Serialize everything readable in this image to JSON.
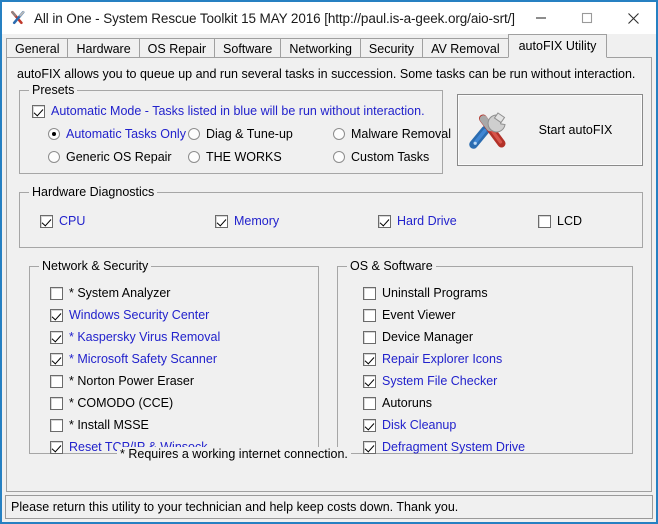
{
  "window": {
    "title": "All in One - System Rescue Toolkit 15 MAY 2016 [http://paul.is-a-geek.org/aio-srt/]",
    "app_icon": "crossed-tools-icon",
    "border_color": "#2680c2",
    "controls": {
      "minimize": "minimize-icon",
      "maximize": "maximize-icon",
      "close": "close-icon"
    }
  },
  "tabs": [
    {
      "label": "General",
      "active": false
    },
    {
      "label": "Hardware",
      "active": false
    },
    {
      "label": "OS Repair",
      "active": false
    },
    {
      "label": "Software",
      "active": false
    },
    {
      "label": "Networking",
      "active": false
    },
    {
      "label": "Security",
      "active": false
    },
    {
      "label": "AV Removal",
      "active": false
    },
    {
      "label": "autoFIX Utility",
      "active": true
    }
  ],
  "intro": "autoFIX allows you to queue up and run several tasks in succession.  Some tasks can be run without interaction.",
  "presets": {
    "title": "Presets",
    "automatic_mode": {
      "label": "Automatic Mode - Tasks listed in blue will be run without interaction.",
      "checked": true,
      "blue": true
    },
    "options": [
      {
        "label": "Automatic Tasks Only",
        "selected": true,
        "blue": true
      },
      {
        "label": "Diag & Tune-up",
        "selected": false,
        "blue": false
      },
      {
        "label": "Malware Removal",
        "selected": false,
        "blue": false
      },
      {
        "label": "Generic OS Repair",
        "selected": false,
        "blue": false
      },
      {
        "label": "THE WORKS",
        "selected": false,
        "blue": false
      },
      {
        "label": "Custom Tasks",
        "selected": false,
        "blue": false
      }
    ]
  },
  "start_button": {
    "label": "Start autoFIX",
    "icon": "screwdriver-wrench-icon"
  },
  "hardware_diagnostics": {
    "title": "Hardware Diagnostics",
    "items": [
      {
        "label": "CPU",
        "checked": true,
        "blue": true
      },
      {
        "label": "Memory",
        "checked": true,
        "blue": true
      },
      {
        "label": "Hard Drive",
        "checked": true,
        "blue": true
      },
      {
        "label": "LCD",
        "checked": false,
        "blue": false
      }
    ]
  },
  "network_security": {
    "title": "Network & Security",
    "items": [
      {
        "label": "* System Analyzer",
        "checked": false,
        "blue": false
      },
      {
        "label": "Windows Security Center",
        "checked": true,
        "blue": true
      },
      {
        "label": "* Kaspersky Virus Removal",
        "checked": true,
        "blue": true
      },
      {
        "label": "* Microsoft Safety Scanner",
        "checked": true,
        "blue": true
      },
      {
        "label": "* Norton Power Eraser",
        "checked": false,
        "blue": false
      },
      {
        "label": "* COMODO (CCE)",
        "checked": false,
        "blue": false
      },
      {
        "label": "* Install MSSE",
        "checked": false,
        "blue": false
      },
      {
        "label": "Reset TCP/IP & Winsock",
        "checked": true,
        "blue": true
      }
    ],
    "footnote": "* Requires a working internet connection."
  },
  "os_software": {
    "title": "OS & Software",
    "items": [
      {
        "label": "Uninstall Programs",
        "checked": false,
        "blue": false
      },
      {
        "label": "Event Viewer",
        "checked": false,
        "blue": false
      },
      {
        "label": "Device Manager",
        "checked": false,
        "blue": false
      },
      {
        "label": "Repair Explorer Icons",
        "checked": true,
        "blue": true
      },
      {
        "label": "System File Checker",
        "checked": true,
        "blue": true
      },
      {
        "label": "Autoruns",
        "checked": false,
        "blue": false
      },
      {
        "label": "Disk Cleanup",
        "checked": true,
        "blue": true
      },
      {
        "label": "Defragment System Drive",
        "checked": true,
        "blue": true
      }
    ]
  },
  "statusbar": {
    "text": "Please return this utility to your technician and help keep costs down. Thank you."
  },
  "colors": {
    "blue_text": "#2222cc",
    "window_border": "#2680c2",
    "face": "#f0f0f0",
    "groupbox_border": "#a6a6a6"
  }
}
